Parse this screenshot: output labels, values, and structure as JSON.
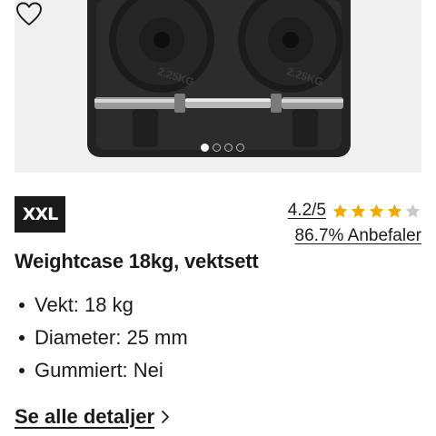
{
  "product_image": {
    "plate_labels": [
      "2.25KG",
      "2.25KG"
    ]
  },
  "carousel": {
    "dots": 4,
    "active_index": 0
  },
  "brand": {
    "logo_text": "XXL"
  },
  "rating": {
    "value_text": "4.2/5",
    "stars_filled": 4,
    "stars_total": 5,
    "recommend_text": "86.7% Anbefaler"
  },
  "product": {
    "title": "Weightcase 18kg, vektsett"
  },
  "specs": [
    "Vekt: 18 kg",
    "Diameter: 25 mm",
    "Gummiert: Nei"
  ],
  "details_link": {
    "label": "Se alle detaljer"
  },
  "colors": {
    "star_filled": "#f2a900",
    "star_empty": "#c8c8c8",
    "text": "#1a1a1a",
    "image_bg": "#f0f0f0"
  },
  "icons": {
    "favorite": "heart-outline-icon",
    "details_arrow": "chevron-right-icon",
    "star": "star-icon"
  }
}
